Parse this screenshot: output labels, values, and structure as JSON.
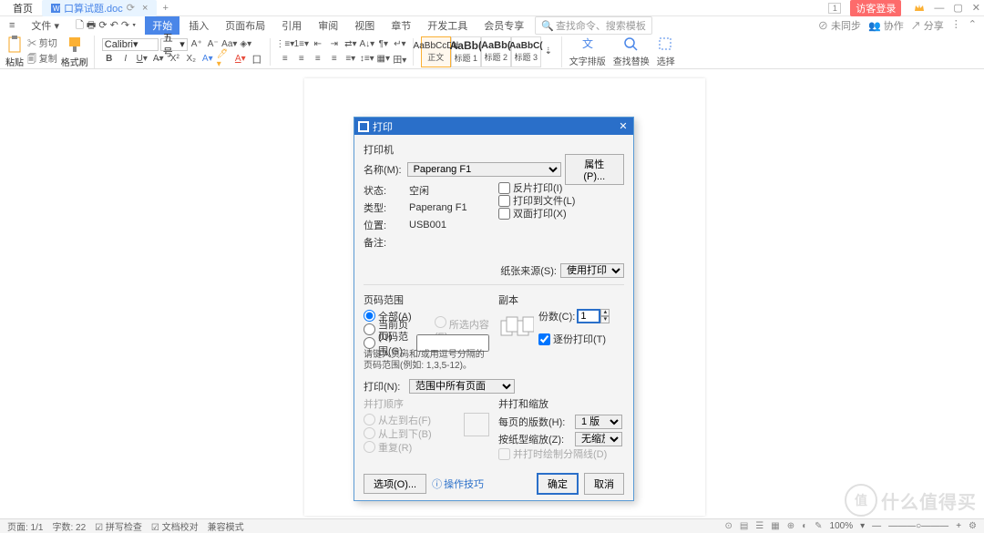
{
  "titlebar": {
    "home_tab": "首页",
    "doc_tab": "口算试题.doc",
    "login": "访客登录",
    "box_num": "1"
  },
  "menubar": {
    "file": "文件",
    "items": [
      "插入",
      "页面布局",
      "引用",
      "审阅",
      "视图",
      "章节",
      "开发工具",
      "会员专享"
    ],
    "active": "开始",
    "search_placeholder": "查找命令、搜索模板",
    "right": {
      "unsync": "未同步",
      "collab": "协作",
      "share": "分享"
    }
  },
  "ribbon": {
    "paste": "粘贴",
    "cut": "剪切",
    "copy": "复制",
    "format_painter": "格式刷",
    "font_name": "Calibri",
    "font_size": "五号",
    "styles": [
      {
        "preview": "AaBbCcDd",
        "label": "正文"
      },
      {
        "preview": "AaBb(",
        "label": "标题 1"
      },
      {
        "preview": "AaBb(",
        "label": "标题 2"
      },
      {
        "preview": "AaBbC(",
        "label": "标题 3"
      }
    ],
    "text_dir": "文字排版",
    "find_replace": "查找替换",
    "select": "选择"
  },
  "dialog": {
    "title": "打印",
    "printer_section": "打印机",
    "name_label": "名称(M):",
    "name_value": "Paperang F1",
    "properties_btn": "属性(P)...",
    "status_label": "状态:",
    "status_value": "空闲",
    "type_label": "类型:",
    "type_value": "Paperang F1",
    "location_label": "位置:",
    "location_value": "USB001",
    "comment_label": "备注:",
    "reverse_print": "反片打印(I)",
    "print_to_file": "打印到文件(L)",
    "duplex": "双面打印(X)",
    "paper_source_label": "纸张来源(S):",
    "paper_source_value": "使用打印机设置",
    "page_range_section": "页码范围",
    "range_all": "全部(A)",
    "range_current": "当前页(U)",
    "range_selection": "所选内容(E)",
    "range_pages": "页码范围(G):",
    "range_hint": "请键入页码和/或用逗号分隔的页码范围(例如: 1,3,5-12)。",
    "print_what_label": "打印(N):",
    "print_what_value": "范围中所有页面",
    "order_section": "并打顺序",
    "order_ltr": "从左到右(F)",
    "order_ttb": "从上到下(B)",
    "order_repeat": "重复(R)",
    "copies_section": "副本",
    "copies_label": "份数(C):",
    "copies_value": "1",
    "collate": "逐份打印(T)",
    "scale_section": "并打和缩放",
    "pages_per_sheet_label": "每页的版数(H):",
    "pages_per_sheet_value": "1 版",
    "scale_to_label": "按纸型缩放(Z):",
    "scale_to_value": "无缩放",
    "draw_divider": "并打时绘制分隔线(D)",
    "options_btn": "选项(O)...",
    "tips_link": "操作技巧",
    "ok_btn": "确定",
    "cancel_btn": "取消"
  },
  "statusbar": {
    "page": "页面: 1/1",
    "words": "字数: 22",
    "spellcheck": "拼写检查",
    "doccheck": "文档校对",
    "compat": "兼容模式",
    "zoom": "100%"
  },
  "watermark": {
    "icon": "值",
    "text": "什么值得买"
  }
}
